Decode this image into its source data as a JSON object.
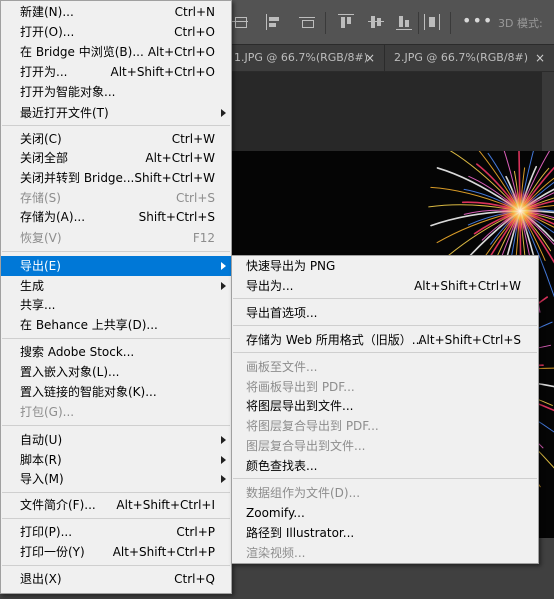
{
  "colors": {
    "menu_bg": "#f0f0f0",
    "highlight": "#0078d7",
    "disabled_text": "#8d8d8d",
    "app_bg": "#535353",
    "canvas_bg": "#050505"
  },
  "toolbar": {
    "more_label": "•••",
    "mode_3d_label": "3D 模式:"
  },
  "tabs": [
    {
      "title": "1.JPG @ 66.7%(RGB/8#)",
      "close": "×"
    },
    {
      "title": "2.JPG @ 66.7%(RGB/8#)",
      "close": "×"
    }
  ],
  "file_menu": {
    "items": [
      {
        "label": "新建(N)...",
        "shortcut": "Ctrl+N",
        "disabled": false,
        "submenu": false
      },
      {
        "label": "打开(O)...",
        "shortcut": "Ctrl+O",
        "disabled": false,
        "submenu": false
      },
      {
        "label": "在 Bridge 中浏览(B)...",
        "shortcut": "Alt+Ctrl+O",
        "disabled": false,
        "submenu": false
      },
      {
        "label": "打开为...",
        "shortcut": "Alt+Shift+Ctrl+O",
        "disabled": false,
        "submenu": false
      },
      {
        "label": "打开为智能对象...",
        "shortcut": "",
        "disabled": false,
        "submenu": false
      },
      {
        "label": "最近打开文件(T)",
        "shortcut": "",
        "disabled": false,
        "submenu": true
      },
      {
        "label": "关闭(C)",
        "shortcut": "Ctrl+W",
        "disabled": false,
        "submenu": false
      },
      {
        "label": "关闭全部",
        "shortcut": "Alt+Ctrl+W",
        "disabled": false,
        "submenu": false
      },
      {
        "label": "关闭并转到 Bridge...",
        "shortcut": "Shift+Ctrl+W",
        "disabled": false,
        "submenu": false
      },
      {
        "label": "存储(S)",
        "shortcut": "Ctrl+S",
        "disabled": true,
        "submenu": false
      },
      {
        "label": "存储为(A)...",
        "shortcut": "Shift+Ctrl+S",
        "disabled": false,
        "submenu": false
      },
      {
        "label": "恢复(V)",
        "shortcut": "F12",
        "disabled": true,
        "submenu": false
      },
      {
        "label": "导出(E)",
        "shortcut": "",
        "disabled": false,
        "submenu": true,
        "active": true
      },
      {
        "label": "生成",
        "shortcut": "",
        "disabled": false,
        "submenu": true
      },
      {
        "label": "共享...",
        "shortcut": "",
        "disabled": false,
        "submenu": false
      },
      {
        "label": "在 Behance 上共享(D)...",
        "shortcut": "",
        "disabled": false,
        "submenu": false
      },
      {
        "label": "搜索 Adobe Stock...",
        "shortcut": "",
        "disabled": false,
        "submenu": false
      },
      {
        "label": "置入嵌入对象(L)...",
        "shortcut": "",
        "disabled": false,
        "submenu": false
      },
      {
        "label": "置入链接的智能对象(K)...",
        "shortcut": "",
        "disabled": false,
        "submenu": false
      },
      {
        "label": "打包(G)...",
        "shortcut": "",
        "disabled": true,
        "submenu": false
      },
      {
        "label": "自动(U)",
        "shortcut": "",
        "disabled": false,
        "submenu": true
      },
      {
        "label": "脚本(R)",
        "shortcut": "",
        "disabled": false,
        "submenu": true
      },
      {
        "label": "导入(M)",
        "shortcut": "",
        "disabled": false,
        "submenu": true
      },
      {
        "label": "文件简介(F)...",
        "shortcut": "Alt+Shift+Ctrl+I",
        "disabled": false,
        "submenu": false
      },
      {
        "label": "打印(P)...",
        "shortcut": "Ctrl+P",
        "disabled": false,
        "submenu": false
      },
      {
        "label": "打印一份(Y)",
        "shortcut": "Alt+Shift+Ctrl+P",
        "disabled": false,
        "submenu": false
      },
      {
        "label": "退出(X)",
        "shortcut": "Ctrl+Q",
        "disabled": false,
        "submenu": false
      }
    ]
  },
  "export_menu": {
    "items": [
      {
        "label": "快速导出为 PNG",
        "shortcut": "",
        "disabled": false
      },
      {
        "label": "导出为...",
        "shortcut": "Alt+Shift+Ctrl+W",
        "disabled": false
      },
      {
        "label": "导出首选项...",
        "shortcut": "",
        "disabled": false
      },
      {
        "label": "存储为 Web 所用格式（旧版）...",
        "shortcut": "Alt+Shift+Ctrl+S",
        "disabled": false
      },
      {
        "label": "画板至文件...",
        "shortcut": "",
        "disabled": true
      },
      {
        "label": "将画板导出到 PDF...",
        "shortcut": "",
        "disabled": true
      },
      {
        "label": "将图层导出到文件...",
        "shortcut": "",
        "disabled": false
      },
      {
        "label": "将图层复合导出到 PDF...",
        "shortcut": "",
        "disabled": true
      },
      {
        "label": "图层复合导出到文件...",
        "shortcut": "",
        "disabled": true
      },
      {
        "label": "颜色查找表...",
        "shortcut": "",
        "disabled": false
      },
      {
        "label": "数据组作为文件(D)...",
        "shortcut": "",
        "disabled": true
      },
      {
        "label": "Zoomify...",
        "shortcut": "",
        "disabled": false
      },
      {
        "label": "路径到 Illustrator...",
        "shortcut": "",
        "disabled": false
      },
      {
        "label": "渲染视频...",
        "shortcut": "",
        "disabled": true
      }
    ]
  }
}
